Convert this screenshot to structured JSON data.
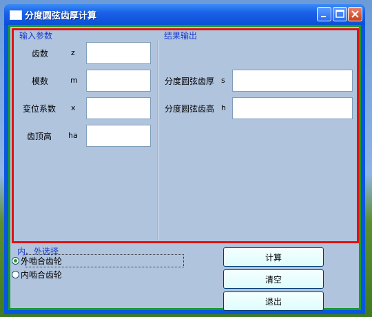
{
  "window": {
    "title": "分度圆弦齿厚计算"
  },
  "input_group": {
    "title": "输入参数",
    "fields": [
      {
        "label": "齿数",
        "symbol": "z",
        "value": ""
      },
      {
        "label": "模数",
        "symbol": "m",
        "value": ""
      },
      {
        "label": "变位系数",
        "symbol": "x",
        "value": ""
      },
      {
        "label": "齿顶高",
        "symbol": "ha",
        "value": ""
      }
    ]
  },
  "output_group": {
    "title": "结果输出",
    "fields": [
      {
        "label": "分度圆弦齿厚",
        "symbol": "s",
        "value": ""
      },
      {
        "label": "分度圆弦齿高",
        "symbol": "h",
        "value": ""
      }
    ]
  },
  "mesh_group": {
    "title": "内、外选择",
    "options": [
      {
        "label": "外啮合齿轮",
        "checked": true
      },
      {
        "label": "内啮合齿轮",
        "checked": false
      }
    ]
  },
  "buttons": {
    "calculate": "计算",
    "clear": "清空",
    "exit": "退出"
  },
  "colors": {
    "panel_bg": "#b0c4de",
    "top_border": "#e01010",
    "outer_border": "#1a9a2a",
    "group_title": "#1a3ad0"
  }
}
